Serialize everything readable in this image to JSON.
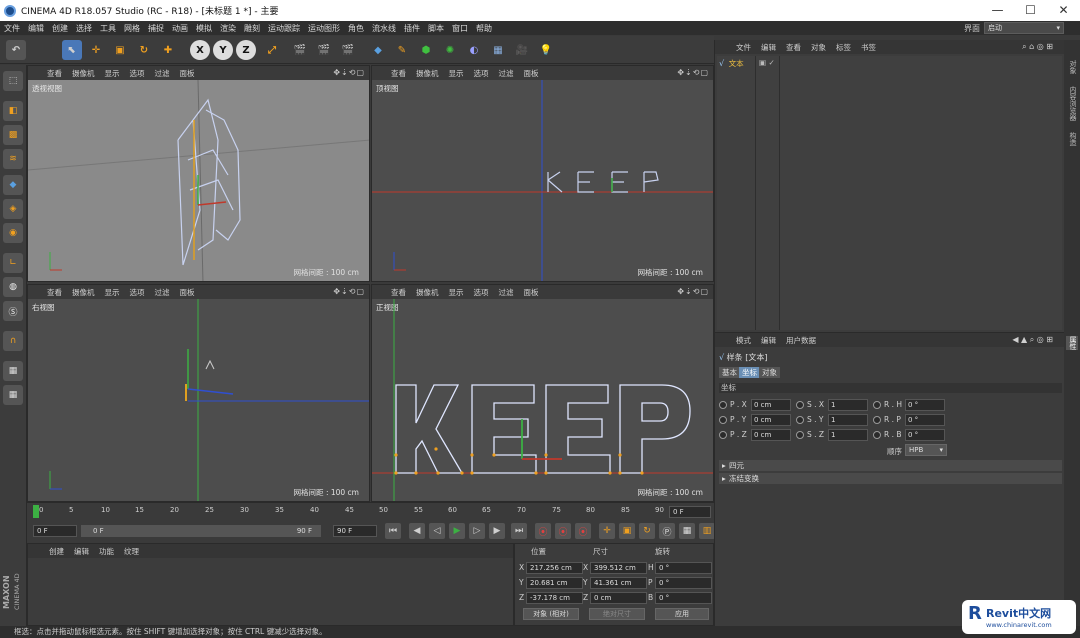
{
  "window": {
    "title": "CINEMA 4D R18.057 Studio (RC - R18) - [未标题 1 *] - 主要",
    "min": "—",
    "max": "☐",
    "close": "✕"
  },
  "menubar": [
    "文件",
    "编辑",
    "创建",
    "选择",
    "工具",
    "网格",
    "捕捉",
    "动画",
    "模拟",
    "渲染",
    "雕刻",
    "运动跟踪",
    "运动图形",
    "角色",
    "流水线",
    "插件",
    "脚本",
    "窗口",
    "帮助"
  ],
  "layout": {
    "label": "界面",
    "value": "启动"
  },
  "toolbar": {
    "axis_x": "X",
    "axis_y": "Y",
    "axis_z": "Z"
  },
  "viewport_menu": [
    "查看",
    "摄像机",
    "显示",
    "选项",
    "过滤",
    "面板"
  ],
  "viewports": [
    {
      "name": "透视视图",
      "grid": "网格间距 : 100 cm"
    },
    {
      "name": "顶视图",
      "grid": "网格间距 : 100 cm"
    },
    {
      "name": "右视图",
      "grid": "网格间距 : 100 cm"
    },
    {
      "name": "正视图",
      "grid": "网格间距 : 100 cm"
    }
  ],
  "timeline": {
    "ticks": [
      "0",
      "5",
      "10",
      "15",
      "20",
      "25",
      "30",
      "35",
      "40",
      "45",
      "50",
      "55",
      "60",
      "65",
      "70",
      "75",
      "80",
      "85",
      "90"
    ],
    "current": "0 F"
  },
  "transport": {
    "start": "0 F",
    "min": "0 F",
    "max": "90 F",
    "end": "90 F"
  },
  "material_menu": [
    "创建",
    "编辑",
    "功能",
    "纹理"
  ],
  "coords": {
    "headers": {
      "pos": "位置",
      "size": "尺寸",
      "rot": "旋转"
    },
    "rows": [
      {
        "axis": "X",
        "pos": "217.256 cm",
        "saxis": "X",
        "size": "399.512 cm",
        "raxis": "H",
        "rot": "0 °"
      },
      {
        "axis": "Y",
        "pos": "20.681 cm",
        "saxis": "Y",
        "size": "41.361 cm",
        "raxis": "P",
        "rot": "0 °"
      },
      {
        "axis": "Z",
        "pos": "-37.178 cm",
        "saxis": "Z",
        "size": "0 cm",
        "raxis": "B",
        "rot": "0 °"
      }
    ],
    "mode": "对象 (相对)",
    "size_mode": "绝对尺寸",
    "apply": "应用"
  },
  "status": "框选：点击并拖动鼠标框选元素。按住 SHIFT 键增加选择对象；按住 CTRL 键减少选择对象。",
  "maxon": {
    "line1": "MAXON",
    "line2": "CINEMA 4D"
  },
  "object_manager": {
    "menu": [
      "文件",
      "编辑",
      "查看",
      "对象",
      "标签",
      "书签"
    ],
    "objects": [
      {
        "name": "文本"
      }
    ]
  },
  "attr_manager": {
    "menu": [
      "模式",
      "编辑",
      "用户数据"
    ],
    "object_title": "样条 [文本]",
    "tabs": [
      "基本",
      "坐标",
      "对象"
    ],
    "active_tab": 1,
    "section": "坐标",
    "rows": [
      [
        {
          "lab": "P . X",
          "val": "0 cm"
        },
        {
          "lab": "S . X",
          "val": "1"
        },
        {
          "lab": "R . H",
          "val": "0 °"
        }
      ],
      [
        {
          "lab": "P . Y",
          "val": "0 cm"
        },
        {
          "lab": "S . Y",
          "val": "1"
        },
        {
          "lab": "R . P",
          "val": "0 °"
        }
      ],
      [
        {
          "lab": "P . Z",
          "val": "0 cm"
        },
        {
          "lab": "S . Z",
          "val": "1"
        },
        {
          "lab": "R . B",
          "val": "0 °"
        }
      ]
    ],
    "order_label": "顺序",
    "order_value": "HPB",
    "collapsed": [
      "四元",
      "冻结变换"
    ]
  },
  "right_tabs": [
    "对象",
    "内容浏览器",
    "构造"
  ],
  "right_tabs2": [
    "属性"
  ],
  "watermark": {
    "brand": "Revit中文网",
    "url": "www.chinarevit.com"
  },
  "colors": {
    "accent": "#6a8fb5",
    "x_axis": "#c0392b",
    "y_axis": "#3cb043",
    "z_axis": "#2f4fd0"
  }
}
